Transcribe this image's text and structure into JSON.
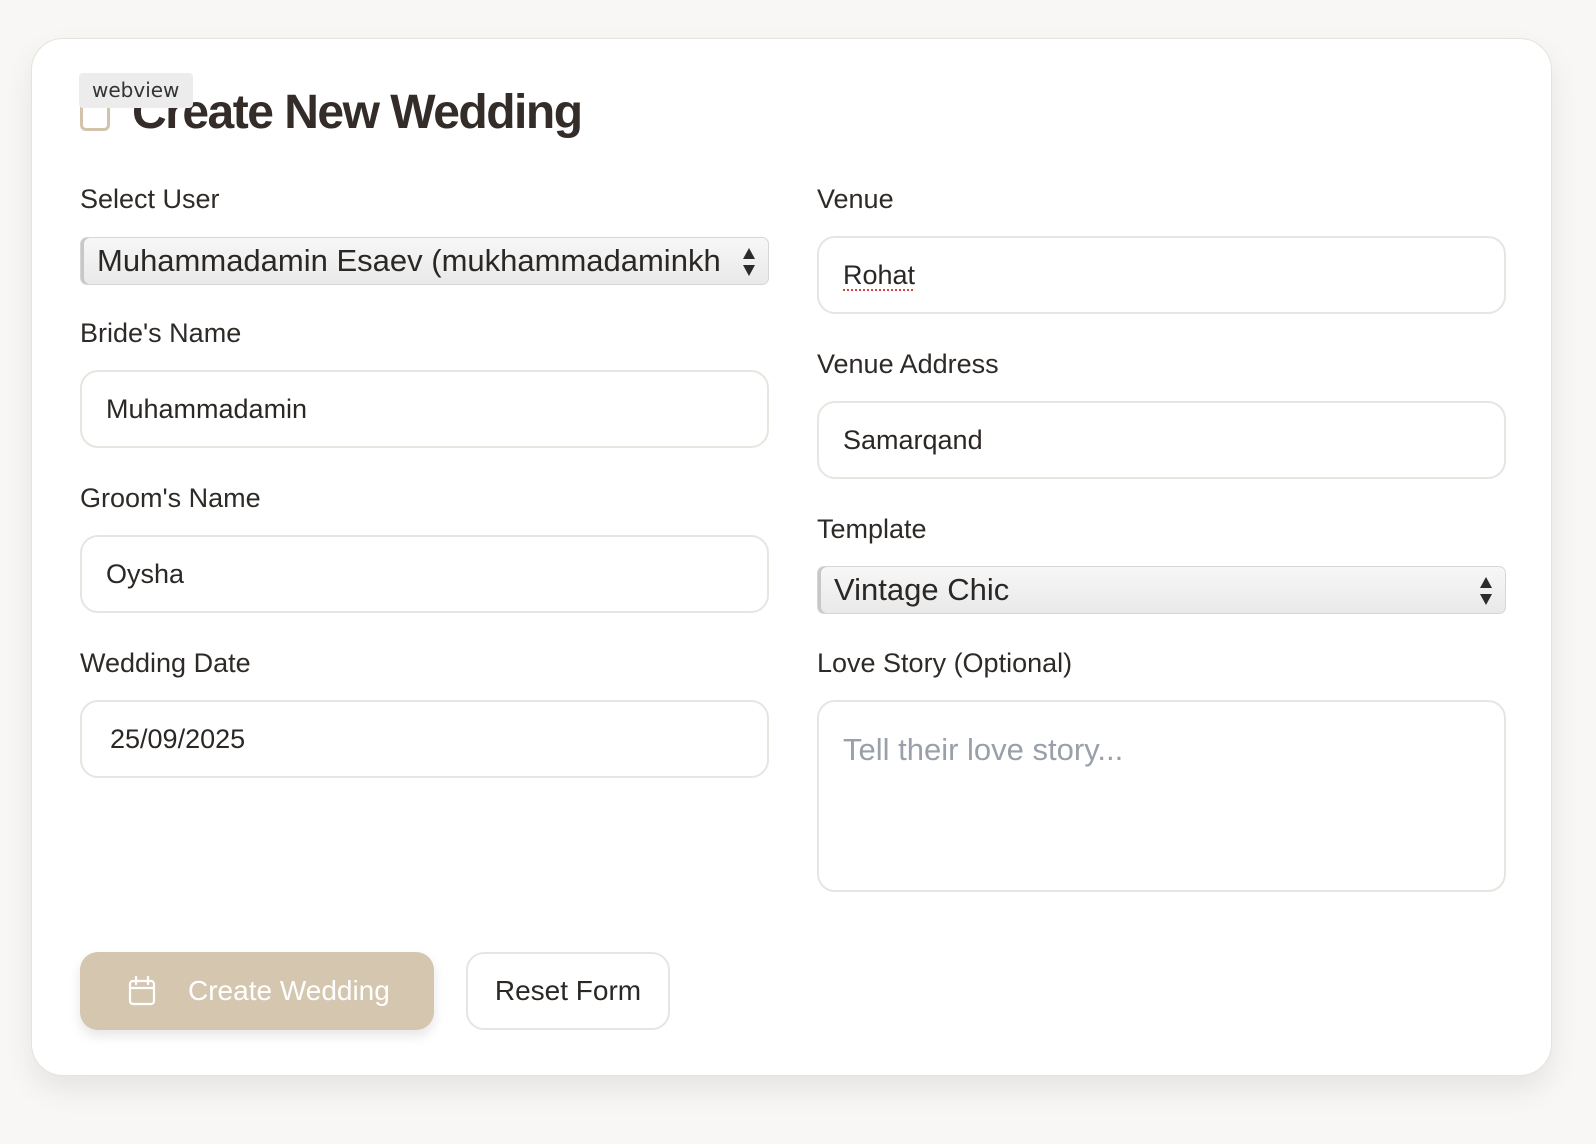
{
  "header": {
    "title": "Create New Wedding",
    "webview_label": "webview"
  },
  "form": {
    "select_user": {
      "label": "Select User",
      "value": "Muhammadamin Esaev (mukhammadaminkhon"
    },
    "bride_name": {
      "label": "Bride's Name",
      "value": "Muhammadamin"
    },
    "groom_name": {
      "label": "Groom's Name",
      "value": "Oysha"
    },
    "wedding_date": {
      "label": "Wedding Date",
      "value": "25/09/2025"
    },
    "venue": {
      "label": "Venue",
      "value": "Rohat"
    },
    "venue_address": {
      "label": "Venue Address",
      "value": "Samarqand"
    },
    "template": {
      "label": "Template",
      "value": "Vintage Chic"
    },
    "love_story": {
      "label": "Love Story (Optional)",
      "placeholder": "Tell their love story..."
    }
  },
  "actions": {
    "create_label": "Create Wedding",
    "reset_label": "Reset Form"
  },
  "icons": {
    "create_button": "calendar-icon",
    "select_arrows": "chevron-up-down-icon"
  },
  "colors": {
    "primary_button": "#d5c6b0",
    "page_background": "#f8f7f5",
    "placeholder_text": "#9aa0a9"
  }
}
